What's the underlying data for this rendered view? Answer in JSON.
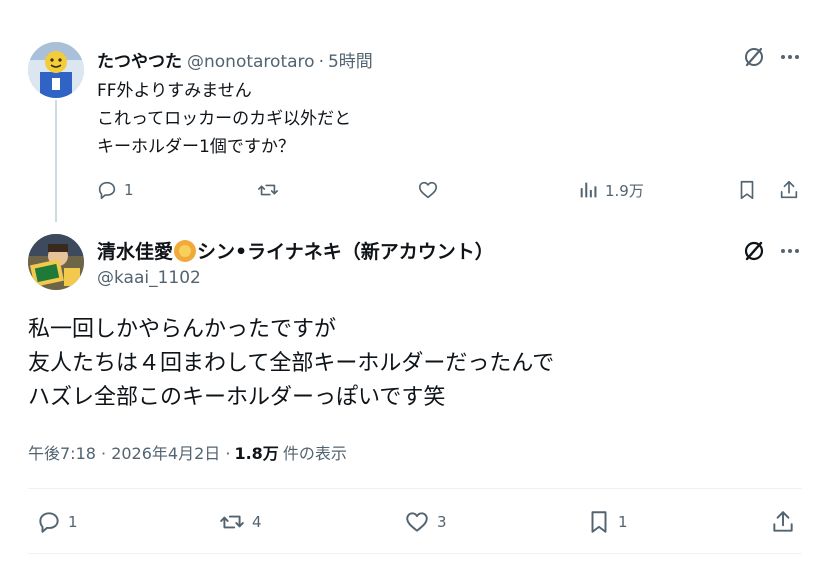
{
  "reply": {
    "author_name": "たつやつた",
    "author_handle": "@nonotarotaro",
    "separator": "·",
    "time": "5時間",
    "lines": [
      "FF外よりすみません",
      "これってロッカーのカギ以外だと",
      "キーホルダー1個ですか？"
    ],
    "actions": {
      "reply_count": "1",
      "retweet_count": "",
      "like_count": "",
      "views_count": "1.9万"
    },
    "icons": [
      "grok-icon",
      "more-icon",
      "reply-icon",
      "retweet-icon",
      "like-icon",
      "views-icon",
      "bookmark-icon",
      "share-icon"
    ]
  },
  "main": {
    "author_name": "清水佳愛🦁シン•ライナネキ（新アカウント）",
    "author_name_before": "清水佳愛",
    "author_name_after": "シン•ライナネキ（新アカウント）",
    "author_handle": "@kaai_1102",
    "lines": [
      "私一回しかやらんかったですが",
      "友人たちは４回まわして全部キーホルダーだったんで",
      "ハズレ全部このキーホルダーっぽいです笑"
    ],
    "timestamp": "午後7:18 · 2026年4月2日 ·",
    "views_count": "1.8万",
    "views_label": "件の表示",
    "actions": {
      "reply_count": "1",
      "retweet_count": "4",
      "like_count": "3",
      "bookmark_count": "1"
    }
  },
  "colors": {
    "text_primary": "#0f1419",
    "text_secondary": "#536471",
    "divider": "#eff3f4",
    "thread_line": "#cfd9de"
  }
}
